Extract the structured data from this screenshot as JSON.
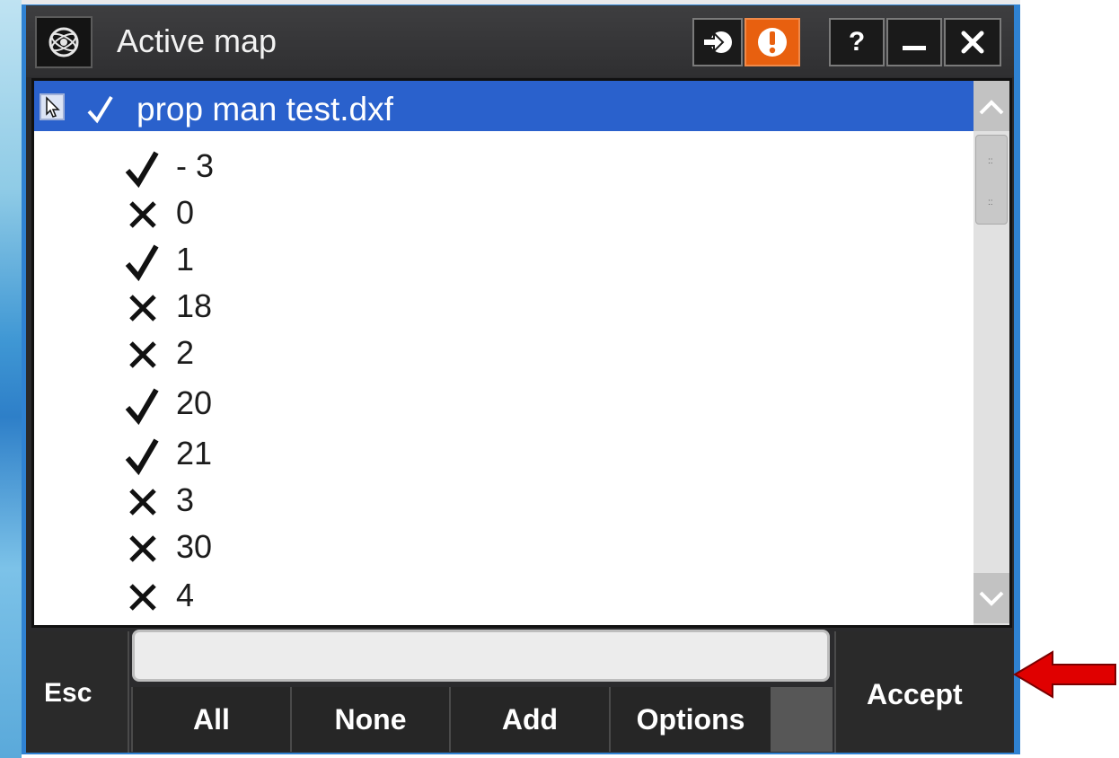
{
  "window": {
    "title": "Active map",
    "titlebar_buttons": [
      {
        "name": "login-icon",
        "glyph": "→"
      },
      {
        "name": "warning-icon",
        "glyph": "!",
        "color": "#e8600f"
      },
      {
        "name": "help-icon",
        "glyph": "?"
      },
      {
        "name": "minimize-icon",
        "glyph": "—"
      },
      {
        "name": "close-icon",
        "glyph": "✕"
      }
    ]
  },
  "list": {
    "selected_item": {
      "label": "prop man test.dxf",
      "checked": true
    },
    "layers": [
      {
        "label": "- 3",
        "checked": true
      },
      {
        "label": "0",
        "checked": false
      },
      {
        "label": "1",
        "checked": true
      },
      {
        "label": "18",
        "checked": false
      },
      {
        "label": "2",
        "checked": false
      },
      {
        "label": "20",
        "checked": true
      },
      {
        "label": "21",
        "checked": true
      },
      {
        "label": "3",
        "checked": false
      },
      {
        "label": "30",
        "checked": false
      },
      {
        "label": "4",
        "checked": false
      }
    ]
  },
  "bottom_bar": {
    "esc_label": "Esc",
    "accept_label": "Accept",
    "input_value": "",
    "buttons": [
      "All",
      "None",
      "Add",
      "Options"
    ]
  },
  "colors": {
    "selection": "#2a61cc",
    "accent_orange": "#e8600f",
    "window_frame": "#2f82d2",
    "annotation_arrow": "#e00000"
  }
}
